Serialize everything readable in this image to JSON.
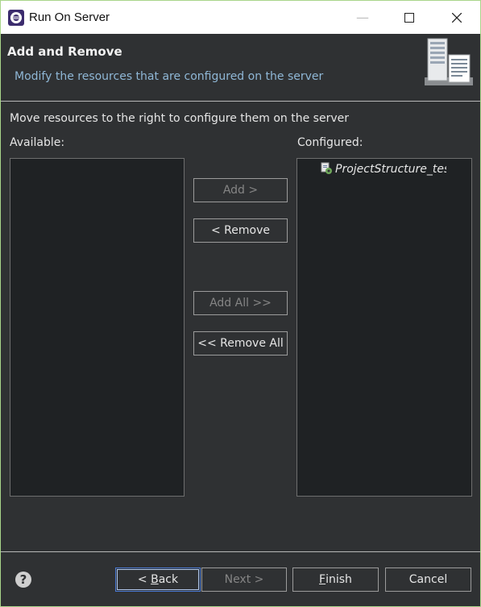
{
  "window": {
    "title": "Run On Server",
    "minimize_glyph": "—",
    "maximize_glyph": "☐",
    "close_glyph": "✕"
  },
  "header": {
    "title": "Add and Remove",
    "description": "Modify the resources that are configured on the server",
    "graphic": "server-graphic"
  },
  "instruction": "Move resources to the right to configure them on the server",
  "available": {
    "label": "Available:",
    "items": []
  },
  "configured": {
    "label": "Configured:",
    "items": [
      {
        "label": "ProjectStructure_test",
        "icon": "project-icon"
      }
    ]
  },
  "buttons": {
    "add": "Add >",
    "remove": "< Remove",
    "add_all": "Add All >>",
    "remove_all": "<< Remove All"
  },
  "footer": {
    "help": "?",
    "back": {
      "prefix": "< ",
      "mnemonic": "B",
      "rest": "ack"
    },
    "next": "Next >",
    "finish": {
      "mnemonic": "F",
      "rest": "inish"
    },
    "cancel": "Cancel"
  },
  "colors": {
    "accent_border": "#a9d58a",
    "dialog_bg": "#2f3133",
    "header_description": "#8fb7d6",
    "focus": "#4b7bd6"
  }
}
